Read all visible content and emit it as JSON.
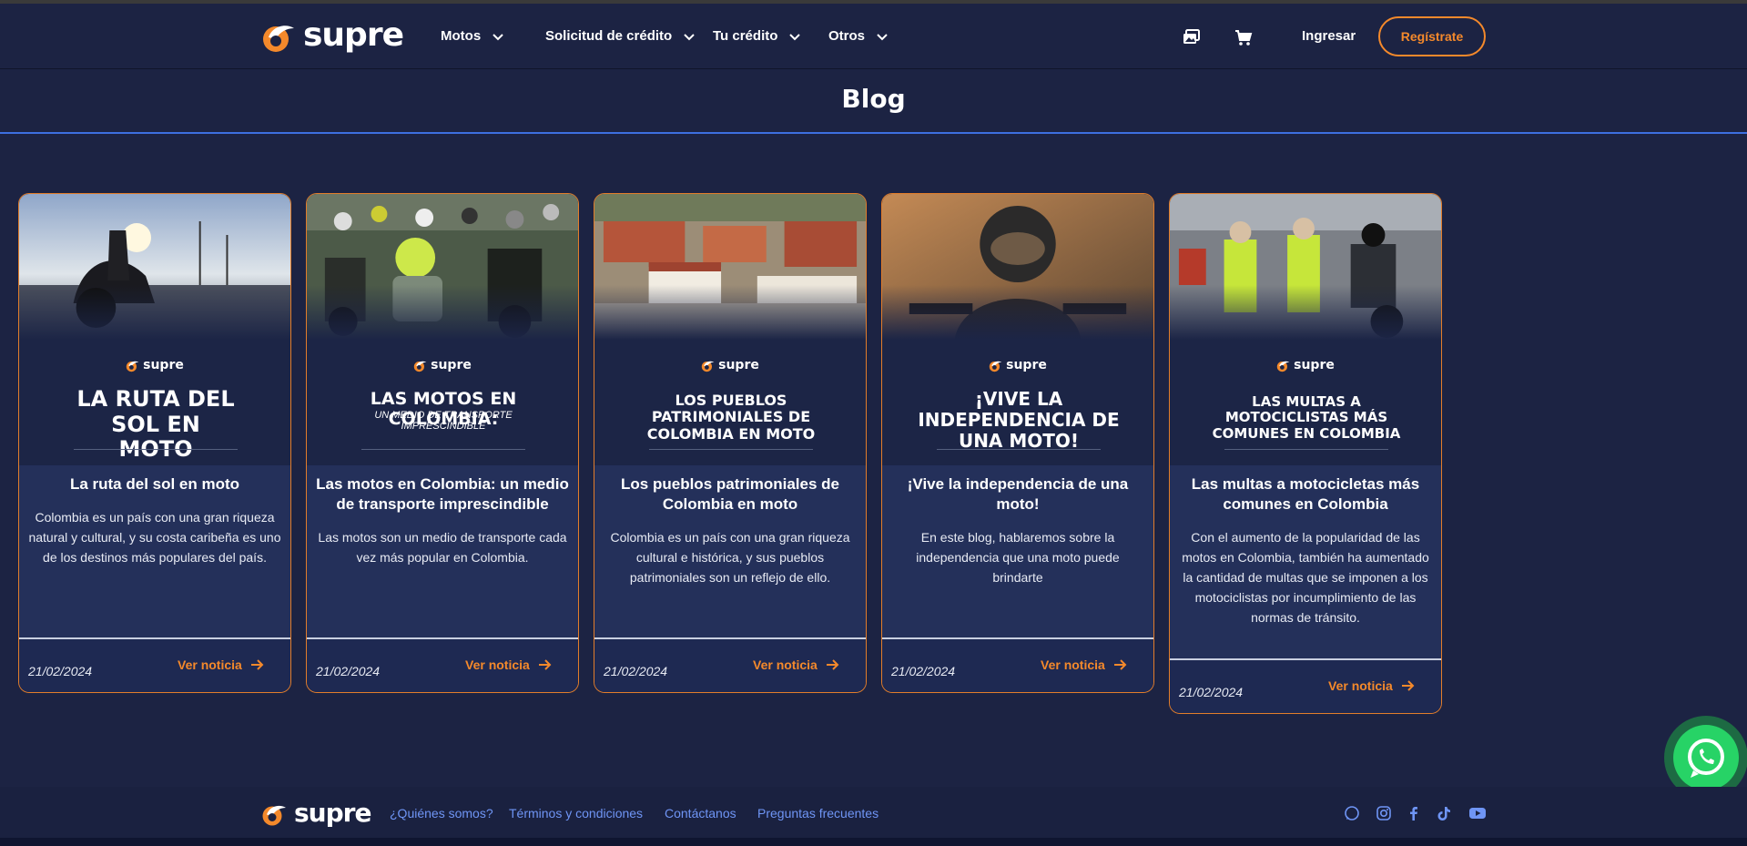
{
  "brand": {
    "name": "supre",
    "orange": "#f4892b",
    "bg": "#1c2343",
    "link_blue": "#6f95f5"
  },
  "header": {
    "nav": [
      {
        "label": "Motos"
      },
      {
        "label": "Solicitud de crédito"
      },
      {
        "label": "Tu crédito"
      },
      {
        "label": "Otros"
      }
    ],
    "icons": [
      "gallery-icon",
      "cart-icon"
    ],
    "login_label": "Ingresar",
    "register_label": "Regístrate"
  },
  "page": {
    "title": "Blog"
  },
  "cards": [
    {
      "hero_title": "La ruta del sol en moto",
      "hero_sub": "",
      "title": "La ruta del sol en moto",
      "description": "Colombia es un país con una gran riqueza natural y cultural, y su costa caribeña es uno de los destinos más populares del país.",
      "date": "21/02/2024",
      "link_label": "Ver noticia"
    },
    {
      "hero_title": "Las motos en Colombia:",
      "hero_sub": "Un medio de transporte imprescindible",
      "title": "Las motos en Colombia: un medio de transporte imprescindible",
      "description": "Las motos son un medio de transporte cada vez más popular en Colombia.",
      "date": "21/02/2024",
      "link_label": "Ver noticia"
    },
    {
      "hero_title": "Los pueblos patrimoniales de Colombia en moto",
      "hero_sub": "",
      "title": "Los pueblos patrimoniales de Colombia en moto",
      "description": "Colombia es un país con una gran riqueza cultural e histórica, y sus pueblos patrimoniales son un reflejo de ello.",
      "date": "21/02/2024",
      "link_label": "Ver noticia"
    },
    {
      "hero_title": "¡Vive la independencia de una moto!",
      "hero_sub": "",
      "title": "¡Vive la independencia de una moto!",
      "description": "En este blog, hablaremos sobre la independencia que una moto puede brindarte",
      "date": "21/02/2024",
      "link_label": "Ver noticia"
    },
    {
      "hero_title": "Las multas a motociclistas más comunes en Colombia",
      "hero_sub": "",
      "title": "Las multas a motocicletas más comunes en Colombia",
      "description": "Con el aumento de la popularidad de las motos en Colombia, también ha aumentado la cantidad de multas que se imponen a los motociclistas por incumplimiento de las normas de tránsito.",
      "date": "21/02/2024",
      "link_label": "Ver noticia"
    }
  ],
  "footer": {
    "links": [
      "¿Quiénes somos?",
      "Términos y condiciones",
      "Contáctanos",
      "Preguntas frecuentes"
    ],
    "social_icons": [
      "whatsapp-icon",
      "instagram-icon",
      "facebook-icon",
      "tiktok-icon",
      "youtube-icon"
    ]
  },
  "floating": {
    "icon": "whatsapp-icon"
  }
}
